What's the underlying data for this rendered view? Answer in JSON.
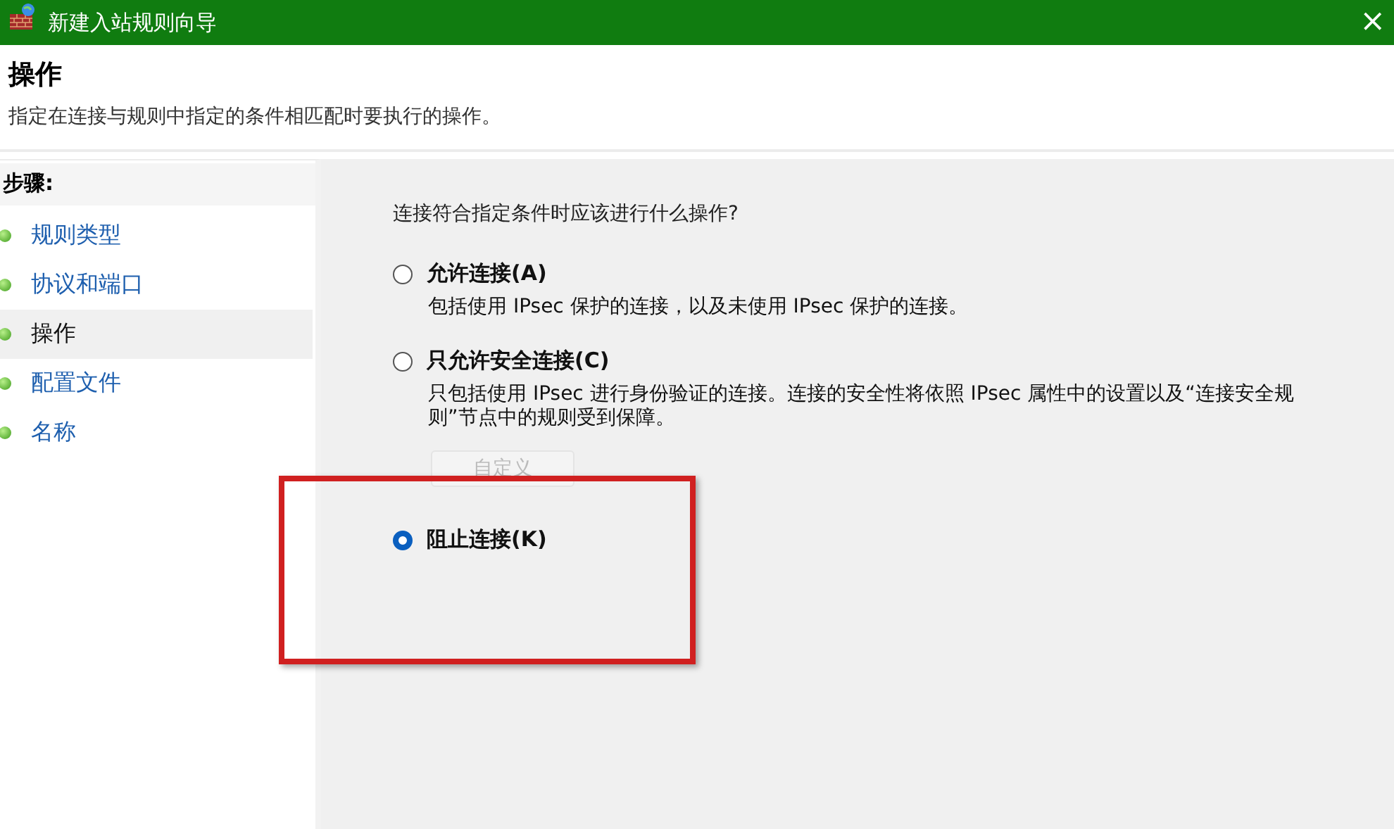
{
  "window": {
    "title": "新建入站规则向导",
    "close": "×"
  },
  "header": {
    "title": "操作",
    "description": "指定在连接与规则中指定的条件相匹配时要执行的操作。"
  },
  "sidebar": {
    "title": "步骤:",
    "items": [
      {
        "label": "规则类型",
        "selected": false
      },
      {
        "label": "协议和端口",
        "selected": false
      },
      {
        "label": "操作",
        "selected": true
      },
      {
        "label": "配置文件",
        "selected": false
      },
      {
        "label": "名称",
        "selected": false
      }
    ]
  },
  "content": {
    "question": "连接符合指定条件时应该进行什么操作?",
    "options": [
      {
        "label": "允许连接(A)",
        "description": "包括使用 IPsec 保护的连接，以及未使用 IPsec 保护的连接。",
        "selected": false,
        "highlighted": false
      },
      {
        "label": "只允许安全连接(C)",
        "description": "只包括使用 IPsec 进行身份验证的连接。连接的安全性将依照 IPsec 属性中的设置以及“连接安全规则”节点中的规则受到保障。",
        "selected": false,
        "highlighted": false,
        "button": {
          "label": "自定义",
          "disabled": true
        }
      },
      {
        "label": "阻止连接(K)",
        "selected": true,
        "highlighted": true
      }
    ]
  }
}
